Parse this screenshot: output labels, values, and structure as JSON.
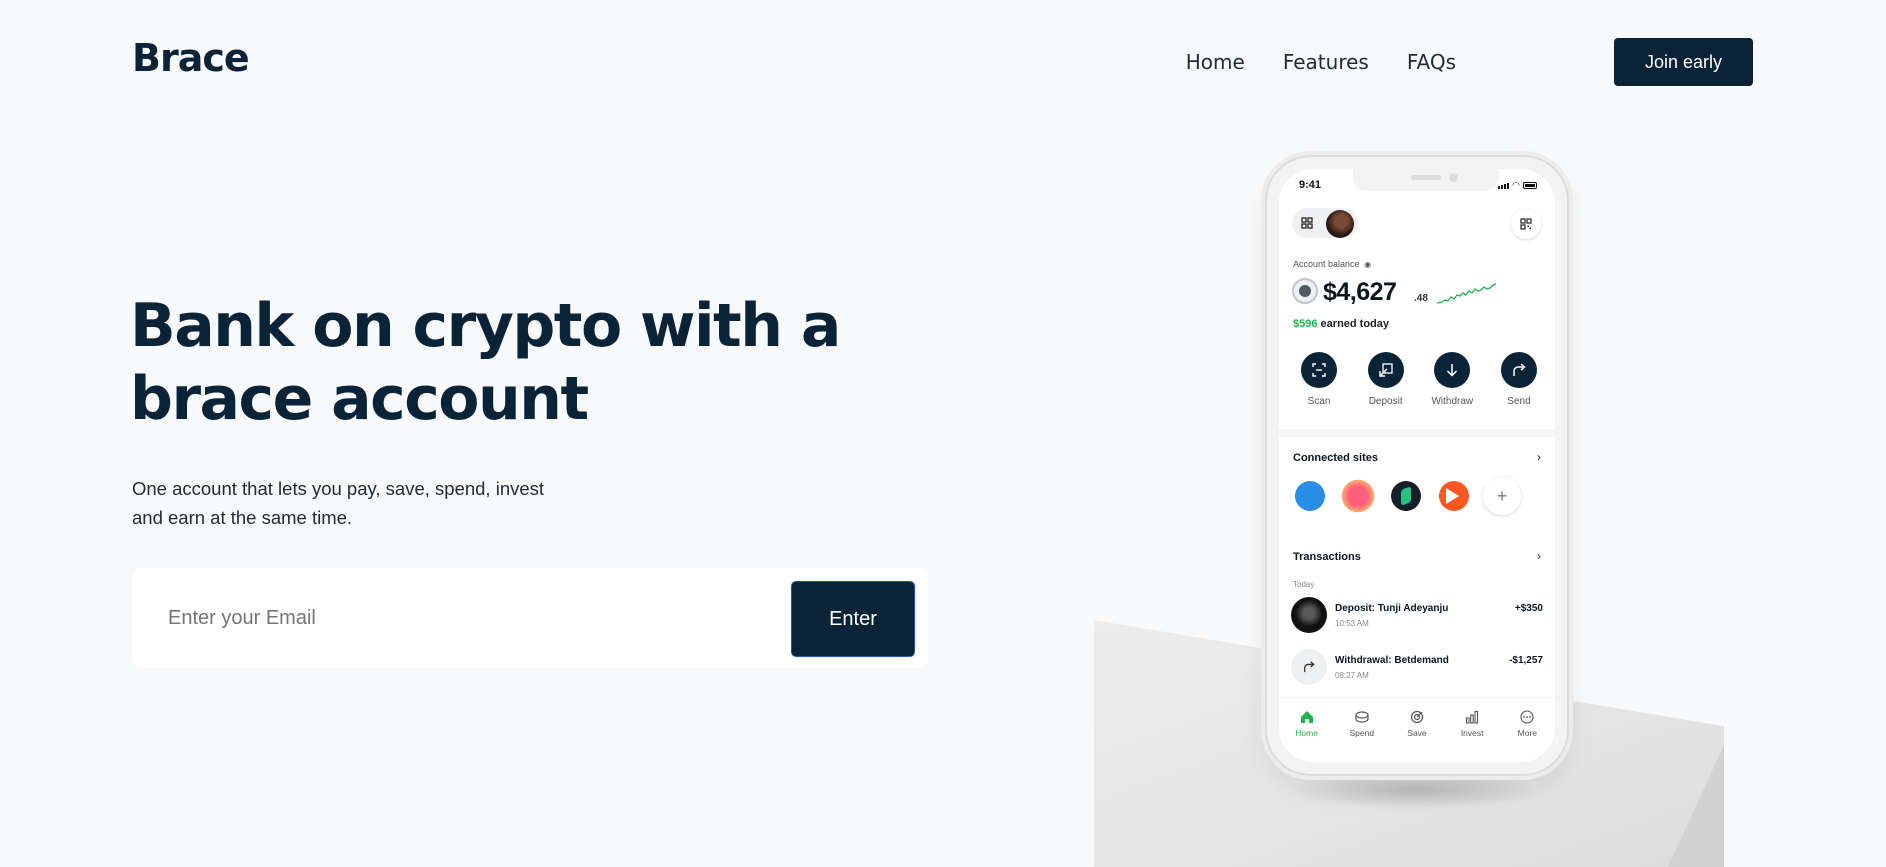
{
  "header": {
    "logo": "Brace",
    "nav": [
      {
        "label": "Home"
      },
      {
        "label": "Features"
      },
      {
        "label": "FAQs"
      }
    ],
    "cta_label": "Join early"
  },
  "hero": {
    "headline": "Bank on crypto with a brace account",
    "subtext": "One account that lets you pay, save, spend, invest and earn at the same time.",
    "email_placeholder": "Enter your Email",
    "enter_label": "Enter"
  },
  "phone": {
    "time": "9:41",
    "balance_label": "Account balance",
    "balance_amount": "$4,627",
    "balance_cents": ".48",
    "earned_amount": "$596",
    "earned_text": "earned today",
    "actions": [
      {
        "label": "Scan",
        "icon": "scan-icon"
      },
      {
        "label": "Deposit",
        "icon": "deposit-icon"
      },
      {
        "label": "Withdraw",
        "icon": "withdraw-icon"
      },
      {
        "label": "Send",
        "icon": "send-icon"
      }
    ],
    "connected_title": "Connected sites",
    "transactions_title": "Transactions",
    "today_label": "Today",
    "transactions": [
      {
        "name": "Deposit: Tunji Adeyanju",
        "time": "10:53 AM",
        "amount": "+$350"
      },
      {
        "name": "Withdrawal: Betdemand",
        "time": "08:27 AM",
        "amount": "-$1,257"
      }
    ],
    "tabs": [
      {
        "label": "Home",
        "icon": "home-icon"
      },
      {
        "label": "Spend",
        "icon": "wallet-icon"
      },
      {
        "label": "Save",
        "icon": "target-icon"
      },
      {
        "label": "Invest",
        "icon": "bar-chart-icon"
      },
      {
        "label": "More",
        "icon": "more-icon"
      }
    ],
    "accent_green": "#22b24c",
    "brand_navy": "#0b2336"
  }
}
